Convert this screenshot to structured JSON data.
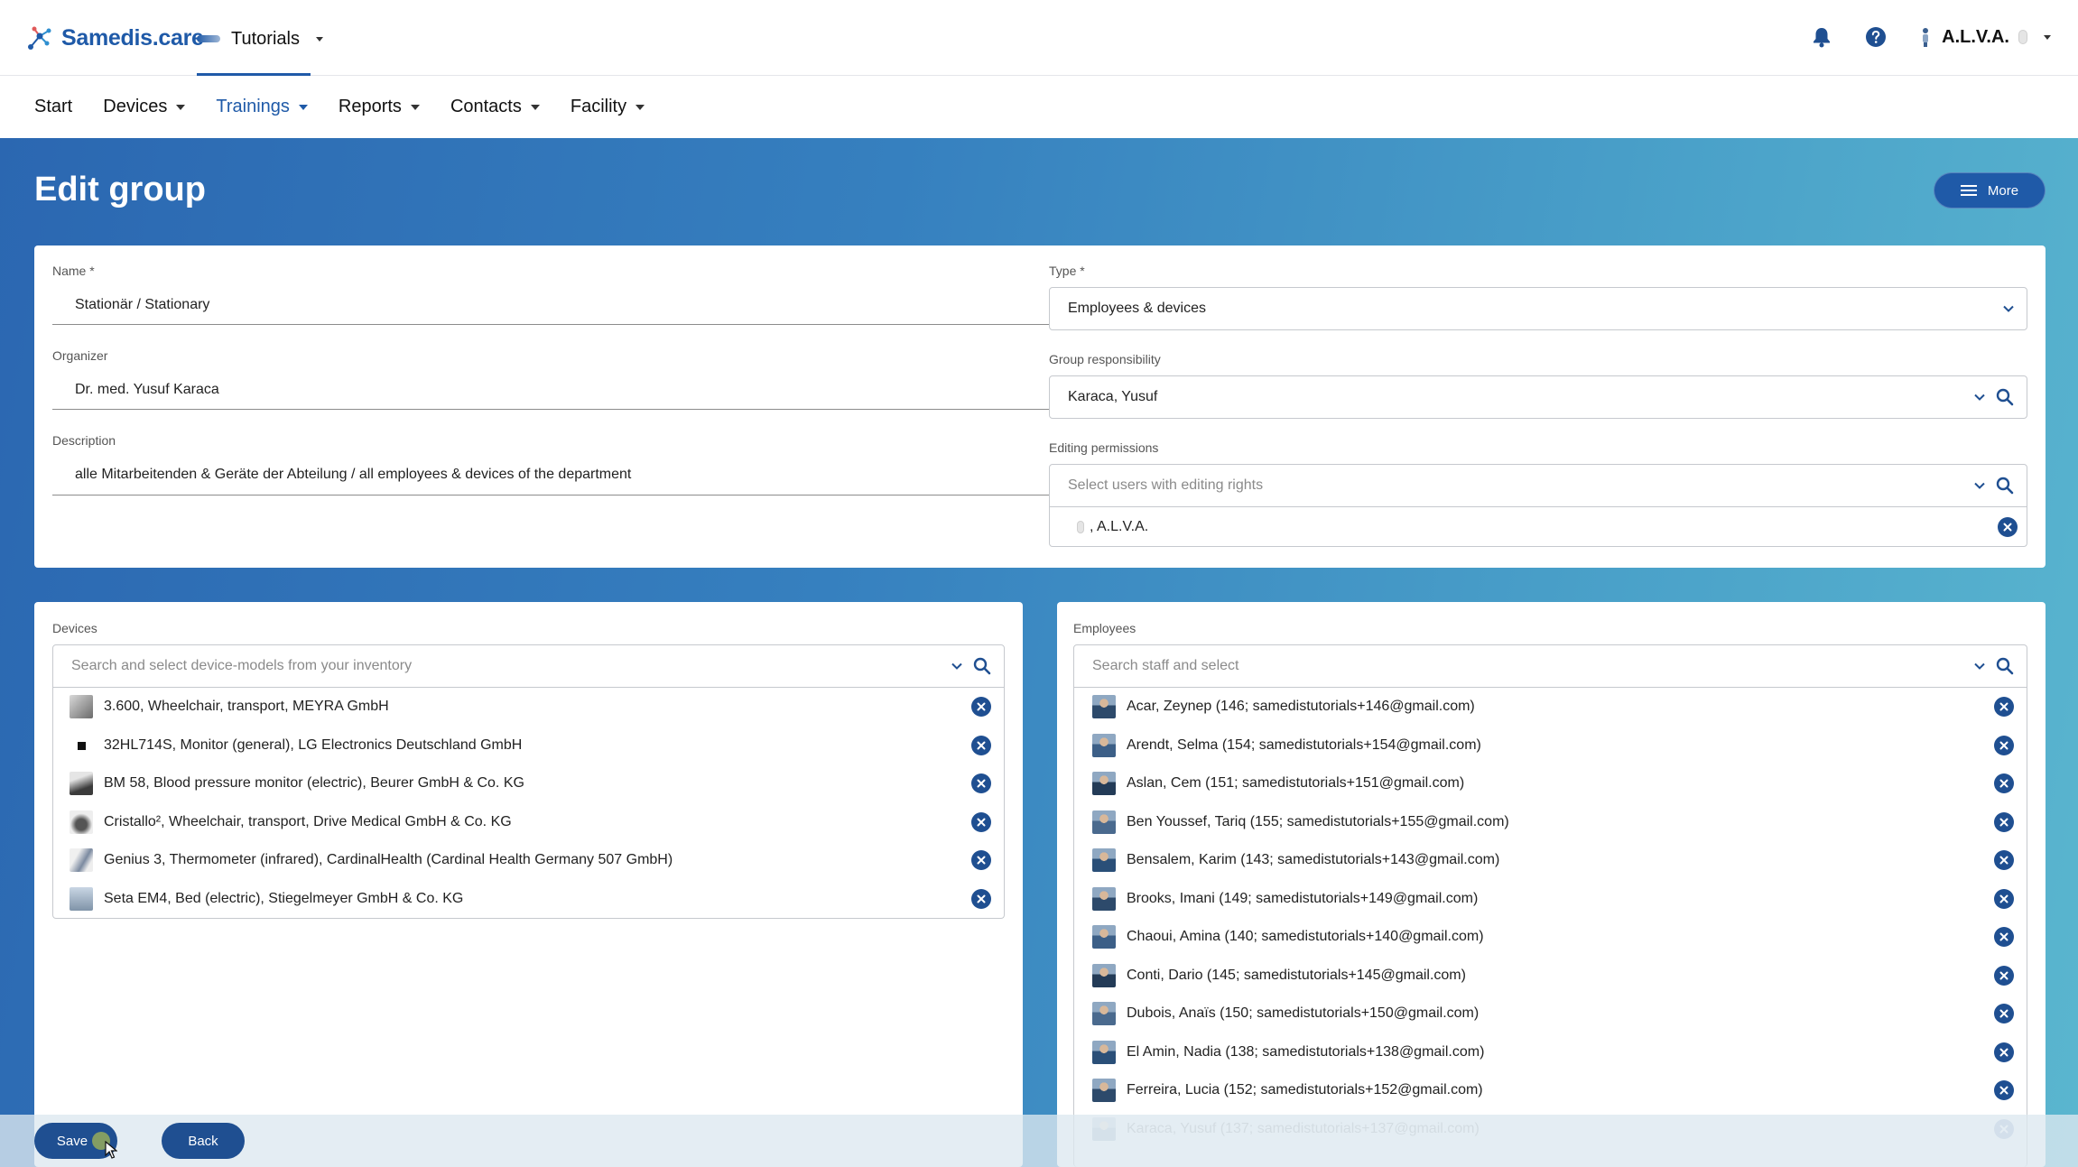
{
  "header": {
    "brand": "Samedis.care",
    "tenant": "Tutorials",
    "user_name": "A.L.V.A."
  },
  "nav": {
    "items": [
      {
        "label": "Start"
      },
      {
        "label": "Devices"
      },
      {
        "label": "Trainings"
      },
      {
        "label": "Reports"
      },
      {
        "label": "Contacts"
      },
      {
        "label": "Facility"
      }
    ],
    "active": "Trainings"
  },
  "page": {
    "title": "Edit group",
    "more_label": "More"
  },
  "form": {
    "name_label": "Name *",
    "name_value": "Stationär / Stationary",
    "organizer_label": "Organizer",
    "organizer_value": "Dr. med. Yusuf Karaca",
    "description_label": "Description",
    "description_value": "alle Mitarbeitenden & Geräte der Abteilung / all employees & devices of the department",
    "type_label": "Type *",
    "type_value": "Employees & devices",
    "responsibility_label": "Group responsibility",
    "responsibility_value": "Karaca, Yusuf",
    "permissions_label": "Editing permissions",
    "permissions_placeholder": "Select users with editing rights",
    "permissions_selected": ", A.L.V.A."
  },
  "devices": {
    "label": "Devices",
    "placeholder": "Search and select device-models from your inventory",
    "items": [
      "3.600, Wheelchair, transport, MEYRA GmbH",
      "32HL714S, Monitor (general), LG Electronics Deutschland GmbH",
      "BM 58, Blood pressure monitor (electric), Beurer GmbH & Co. KG",
      "Cristallo², Wheelchair, transport, Drive Medical GmbH & Co. KG",
      "Genius 3, Thermometer (infrared), CardinalHealth (Cardinal Health Germany 507 GmbH)",
      "Seta EM4, Bed (electric), Stiegelmeyer GmbH & Co. KG"
    ]
  },
  "employees": {
    "label": "Employees",
    "placeholder": "Search staff and select",
    "items": [
      "Acar, Zeynep (146; samedistutorials+146@gmail.com)",
      "Arendt, Selma (154; samedistutorials+154@gmail.com)",
      "Aslan, Cem (151; samedistutorials+151@gmail.com)",
      "Ben Youssef, Tariq (155; samedistutorials+155@gmail.com)",
      "Bensalem, Karim (143; samedistutorials+143@gmail.com)",
      "Brooks, Imani (149; samedistutorials+149@gmail.com)",
      "Chaoui, Amina (140; samedistutorials+140@gmail.com)",
      "Conti, Dario (145; samedistutorials+145@gmail.com)",
      "Dubois, Anaïs (150; samedistutorials+150@gmail.com)",
      "El Amin, Nadia (138; samedistutorials+138@gmail.com)",
      "Ferreira, Lucia (152; samedistutorials+152@gmail.com)",
      "Karaca, Yusuf (137; samedistutorials+137@gmail.com)"
    ]
  },
  "actions": {
    "save_label": "Save",
    "back_label": "Back"
  },
  "colors": {
    "primary": "#1f5aa8",
    "button": "#1f4f91",
    "gradient_start": "#2b67b1",
    "gradient_end": "#5ab6cf"
  }
}
